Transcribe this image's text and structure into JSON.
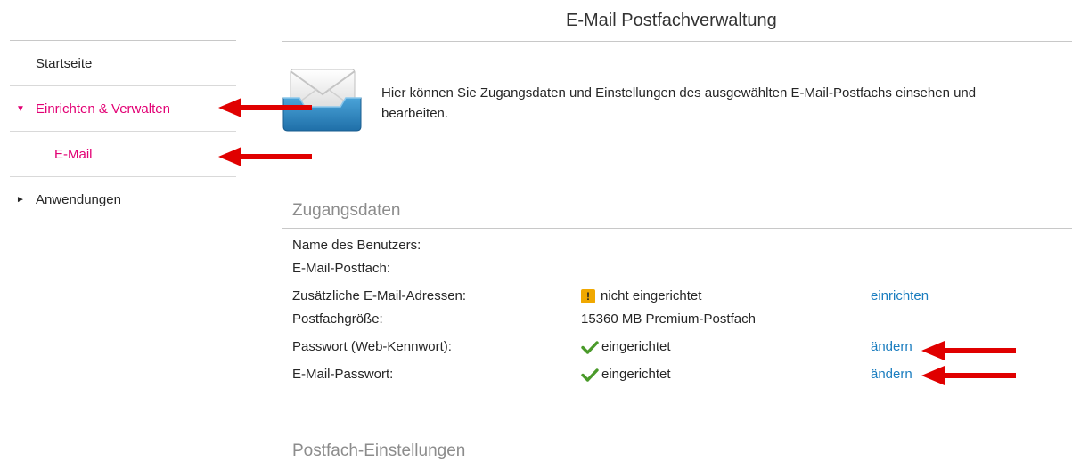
{
  "page_title": "E-Mail Postfachverwaltung",
  "sidebar": {
    "items": [
      {
        "label": "Startseite"
      },
      {
        "label": "Einrichten & Verwalten",
        "marker": "▼"
      },
      {
        "label": "E-Mail"
      },
      {
        "label": "Anwendungen",
        "marker": "►"
      }
    ]
  },
  "intro_text": "Hier können Sie Zugangsdaten und Einstellungen des ausgewählten E-Mail-Postfachs einsehen und bearbeiten.",
  "sections": {
    "zugangsdaten": "Zugangsdaten",
    "postfach": "Postfach-Einstellungen"
  },
  "rows": [
    {
      "label": "Name des Benutzers:",
      "value": "",
      "action": ""
    },
    {
      "label": "E-Mail-Postfach:",
      "value": "",
      "action": ""
    },
    {
      "label": "Zusätzliche E-Mail-Adressen:",
      "value": "nicht eingerichtet",
      "status": "warning",
      "action": "einrichten"
    },
    {
      "label": "Postfachgröße:",
      "value": "15360 MB Premium-Postfach",
      "action": ""
    },
    {
      "label": "Passwort (Web-Kennwort):",
      "value": "eingerichtet",
      "status": "ok",
      "action": "ändern"
    },
    {
      "label": "E-Mail-Passwort:",
      "value": "eingerichtet",
      "status": "ok",
      "action": "ändern"
    }
  ],
  "warning_symbol": "!",
  "colors": {
    "accent": "#e20074",
    "link": "#1a7dbf",
    "check": "#4a9a2a",
    "warning": "#f0a800",
    "annotation_arrow": "#e00000"
  },
  "icons": {
    "mail": "envelope-inbox-icon",
    "ok": "checkmark-icon",
    "warning": "warning-icon"
  }
}
